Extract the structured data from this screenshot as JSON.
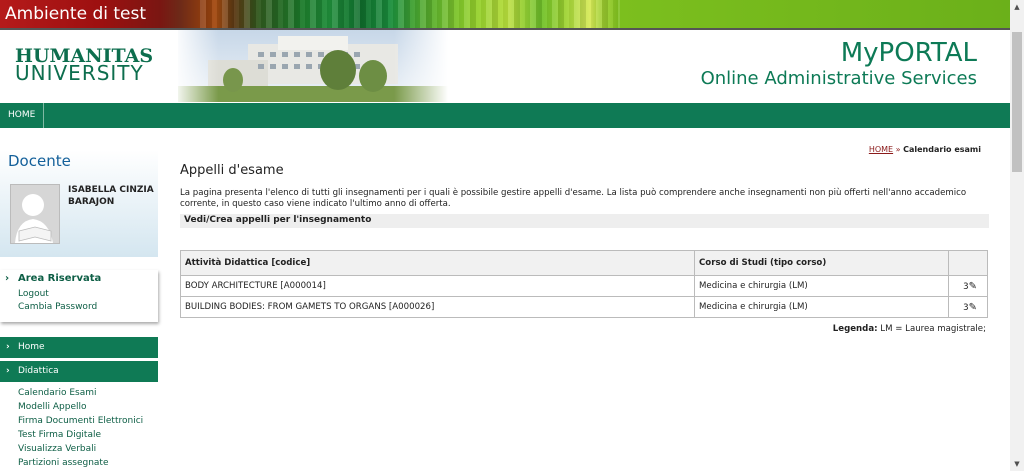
{
  "topbar": {
    "title": "Ambiente di test"
  },
  "header": {
    "logo_line1": "HUMANITAS",
    "logo_line2": "UNIVERSITY",
    "portal_title": "MyPORTAL",
    "portal_subtitle": "Online Administrative Services"
  },
  "nav": {
    "home": "HOME"
  },
  "sidebar": {
    "docente_title": "Docente",
    "user_name_line1": "ISABELLA CINZIA",
    "user_name_line2": "BARAJON",
    "area_riservata": "Area Riservata",
    "logout": "Logout",
    "cambia_password": "Cambia Password",
    "menu_home": "Home",
    "menu_didattica": "Didattica",
    "sub_items": [
      "Calendario Esami",
      "Modelli Appello",
      "Firma Documenti Elettronici",
      "Test Firma Digitale",
      "Visualizza Verbali",
      "Partizioni assegnate"
    ]
  },
  "breadcrumb": {
    "home": "HOME",
    "separator": "»",
    "current": "Calendario esami"
  },
  "main": {
    "title": "Appelli d'esame",
    "description": "La pagina presenta l'elenco di tutti gli insegnamenti per i quali è possibile gestire appelli d'esame. La lista può comprendere anche insegnamenti non più offerti nell'anno accademico corrente, in questo caso viene indicato l'ultimo anno di offerta.",
    "section_label": "Vedi/Crea appelli per l'insegnamento",
    "table": {
      "headers": [
        "Attività Didattica [codice]",
        "Corso di Studi (tipo corso)",
        ""
      ],
      "rows": [
        {
          "attivita": "BODY ARCHITECTURE [A000014]",
          "corso": "Medicina e chirurgia (LM)",
          "count": "3"
        },
        {
          "attivita": "BUILDING BODIES: FROM GAMETS TO ORGANS [A000026]",
          "corso": "Medicina e chirurgia (LM)",
          "count": "3"
        }
      ]
    },
    "legend_label": "Legenda:",
    "legend_text": "LM = Laurea magistrale;"
  }
}
